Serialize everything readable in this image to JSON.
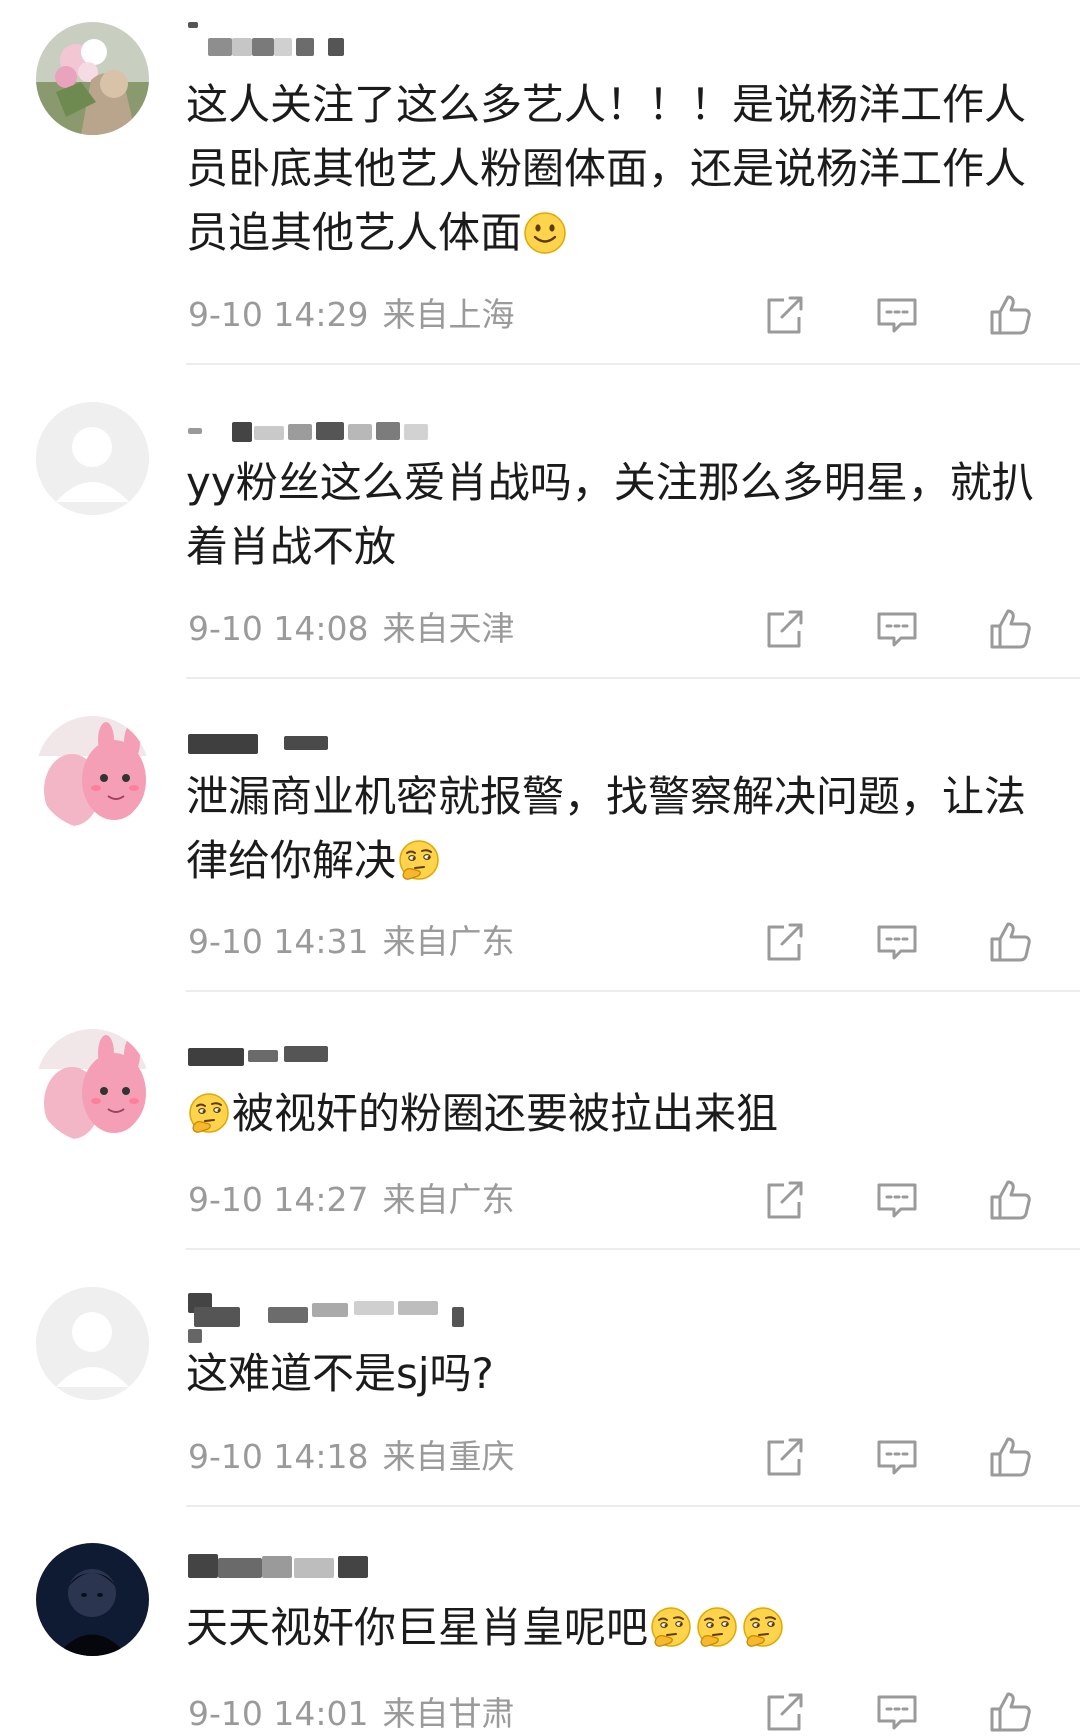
{
  "comments": [
    {
      "username": "",
      "text_parts": [
        "这人关注了这么多艺人！！！是说杨洋工作人员卧底其他艺人粉圈体面，还是说杨洋工作人员追其他艺人体面"
      ],
      "emojis": [
        "smile-emoji"
      ],
      "date": "9-10 14:29",
      "location": "来自上海"
    },
    {
      "username": "",
      "text_parts": [
        "yy粉丝这么爱肖战吗，关注那么多明星，就扒着肖战不放"
      ],
      "emojis": [],
      "date": "9-10 14:08",
      "location": "来自天津"
    },
    {
      "username": "",
      "text_parts": [
        "泄漏商业机密就报警，找警察解决问题，让法律给你解决"
      ],
      "emojis": [
        "thinking-emoji"
      ],
      "date": "9-10 14:31",
      "location": "来自广东"
    },
    {
      "username": "",
      "text_parts": [
        "被视奸的粉圈还要被拉出来狙"
      ],
      "emojis": [
        "thinking-emoji"
      ],
      "date": "9-10 14:27",
      "location": "来自广东"
    },
    {
      "username": "",
      "text_parts": [
        "这难道不是sj吗?"
      ],
      "emojis": [],
      "date": "9-10 14:18",
      "location": "来自重庆"
    },
    {
      "username": "",
      "text_parts": [
        "天天视奸你巨星肖皇呢吧"
      ],
      "emojis": [
        "thinking-emoji",
        "thinking-emoji",
        "thinking-emoji"
      ],
      "date": "9-10 14:01",
      "location": "来自甘肃"
    }
  ],
  "icons": {
    "share": "share-icon",
    "reply": "comment-icon",
    "like": "thumbs-up-icon"
  },
  "colors": {
    "text": "#1b1b1b",
    "meta": "#9a9a9a",
    "icon": "#9a9a9a",
    "divider": "#ececec"
  }
}
